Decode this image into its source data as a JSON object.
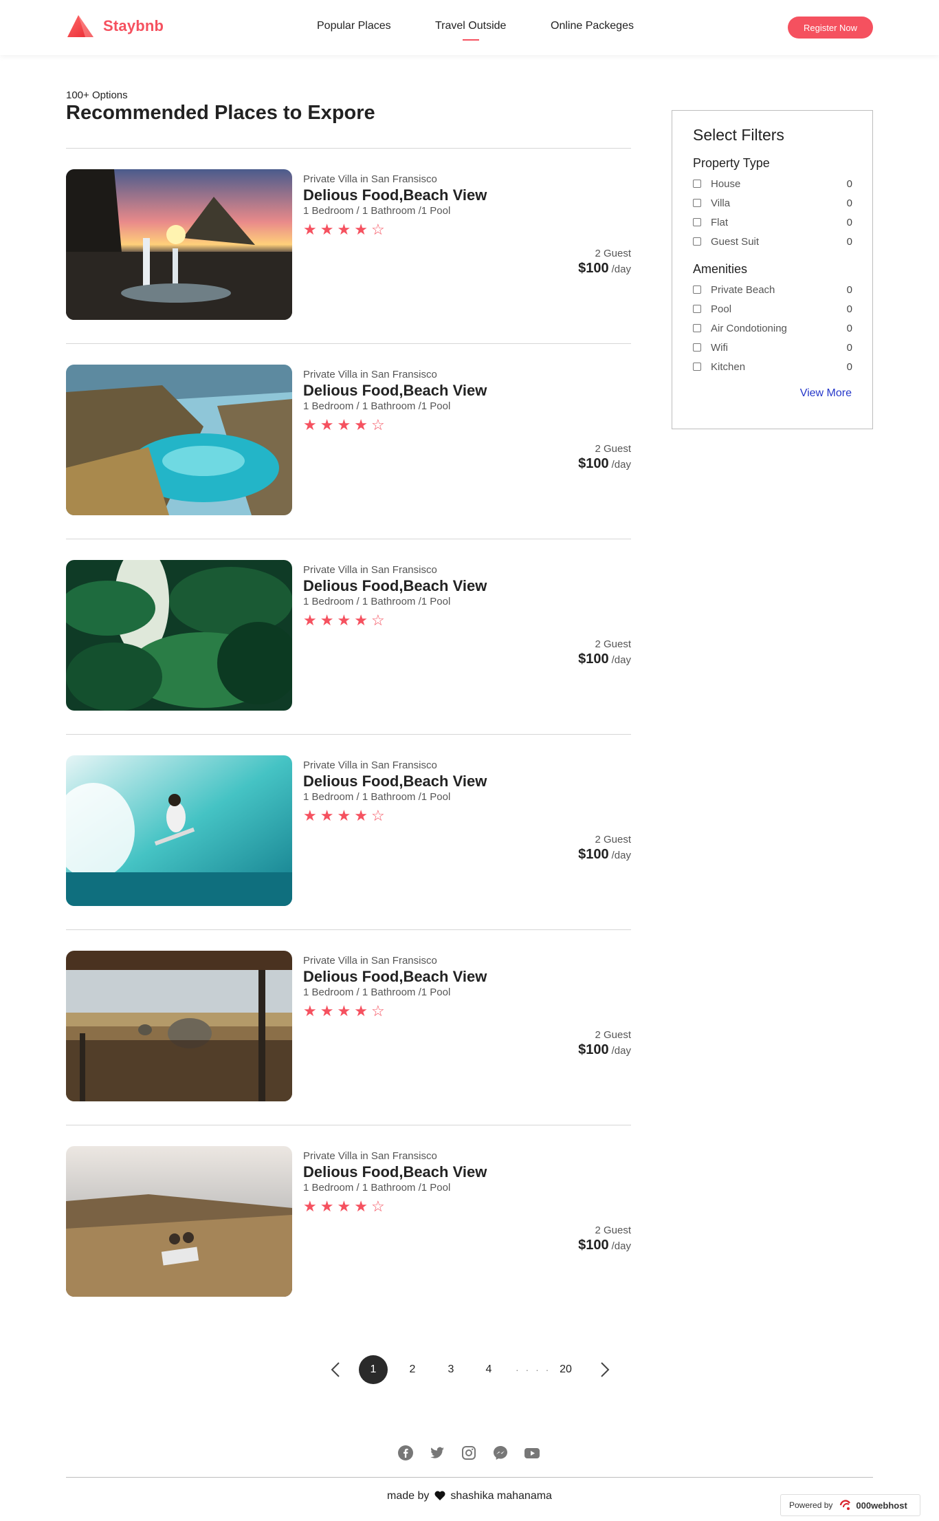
{
  "brand": {
    "name": "Staybnb",
    "color": "#f5515f"
  },
  "nav": [
    {
      "label": "Popular Places",
      "active": false
    },
    {
      "label": "Travel Outside",
      "active": true
    },
    {
      "label": "Online Packeges",
      "active": false
    }
  ],
  "header": {
    "register_label": "Register Now"
  },
  "listing_header": {
    "options": "100+ Options",
    "title": "Recommended Places to Expore"
  },
  "listings": [
    {
      "location": "Private Villa in San Fransisco",
      "name": "Delious Food,Beach View",
      "specs": "1 Bedroom / 1 Bathroom /1 Pool",
      "rating": 3.5,
      "guests": "2 Guest",
      "price": "$100",
      "per": "/day",
      "photo": "waterfall-sunset"
    },
    {
      "location": "Private Villa in San Fransisco",
      "name": "Delious Food,Beach View",
      "specs": "1 Bedroom / 1 Bathroom /1 Pool",
      "rating": 3.5,
      "guests": "2 Guest",
      "price": "$100",
      "per": "/day",
      "photo": "turquoise-cove"
    },
    {
      "location": "Private Villa in San Fransisco",
      "name": "Delious Food,Beach View",
      "specs": "1 Bedroom / 1 Bathroom /1 Pool",
      "rating": 3.5,
      "guests": "2 Guest",
      "price": "$100",
      "per": "/day",
      "photo": "jungle-leaves"
    },
    {
      "location": "Private Villa in San Fransisco",
      "name": "Delious Food,Beach View",
      "specs": "1 Bedroom / 1 Bathroom /1 Pool",
      "rating": 3.5,
      "guests": "2 Guest",
      "price": "$100",
      "per": "/day",
      "photo": "surfer-wave"
    },
    {
      "location": "Private Villa in San Fransisco",
      "name": "Delious Food,Beach View",
      "specs": "1 Bedroom / 1 Bathroom /1 Pool",
      "rating": 3.5,
      "guests": "2 Guest",
      "price": "$100",
      "per": "/day",
      "photo": "safari-elephants"
    },
    {
      "location": "Private Villa in San Fransisco",
      "name": "Delious Food,Beach View",
      "specs": "1 Bedroom / 1 Bathroom /1 Pool",
      "rating": 3.5,
      "guests": "2 Guest",
      "price": "$100",
      "per": "/day",
      "photo": "hilltop-picnic"
    }
  ],
  "filters": {
    "title": "Select Filters",
    "property_type": {
      "heading": "Property Type",
      "items": [
        {
          "label": "House",
          "count": "0"
        },
        {
          "label": "Villa",
          "count": "0"
        },
        {
          "label": "Flat",
          "count": "0"
        },
        {
          "label": "Guest Suit",
          "count": "0"
        }
      ]
    },
    "amenities": {
      "heading": "Amenities",
      "items": [
        {
          "label": "Private Beach",
          "count": "0"
        },
        {
          "label": "Pool",
          "count": "0"
        },
        {
          "label": "Air Condotioning",
          "count": "0"
        },
        {
          "label": "Wifi",
          "count": "0"
        },
        {
          "label": "Kitchen",
          "count": "0"
        }
      ]
    },
    "view_more": "View More"
  },
  "pagination": {
    "pages": [
      "1",
      "2",
      "3",
      "4"
    ],
    "dots": "· · · ·",
    "last": "20",
    "current": "1"
  },
  "footer": {
    "socials": [
      "facebook-icon",
      "twitter-icon",
      "instagram-icon",
      "messenger-icon",
      "youtube-icon"
    ],
    "made_by": "made by",
    "author": "shashika mahanama",
    "powered_by": "Powered by",
    "host": "000webhost"
  }
}
